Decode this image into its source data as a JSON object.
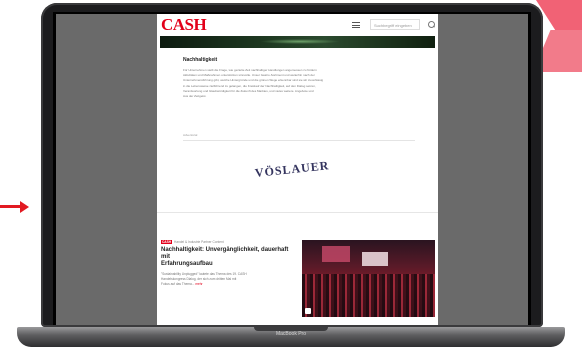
{
  "site": {
    "logo": "CASH",
    "search_placeholder": "Suchbegriff eingeben"
  },
  "article": {
    "title": "Nachhaltigkeit",
    "body_lines": [
      "Für Unternehmen stellt die Frage, wie gezielte Zeit nachhaltiger Handlungen angemessen zu fördern",
      "Aktivitäten und Maßnahmen unterstützen sinnvolle. Unser Gastro-Sortiment und weiterhin nach der",
      "Unternehmensführung gibt, welche Hintergründe und die grünen Wege erkennbar sind sie wir zuverlässig",
      "in die Lebensweise zielführend zu gelangen, die Kreislauf der Nachhaltigkeit, auf den Dialog setzen,",
      "Verantwortung und Glaubwürdigkeit für die Zukunft des Marktes, und vieles weitere. Angebote und",
      "Aus der Zeitgeist."
    ]
  },
  "ad": {
    "label": "Advertorial",
    "brand": "VÖSLAUER"
  },
  "teaser": {
    "tag": "CASH",
    "kicker": "Handel & Industrie Partner Content",
    "title_line1": "Nachhaltigkeit: Unvergänglichkeit, dauerhaft mit",
    "title_line2": "Erfahrungsaufbau",
    "body_lines": [
      "\"Sustainability Unplugged\" lautete das Thema des 19. CASH",
      "Handelskongress Dialog, der sich zum dritten Mal mit",
      "Fokus auf das Thema..."
    ],
    "more": "mehr"
  },
  "laptop": {
    "model": "MacBook Pro"
  }
}
